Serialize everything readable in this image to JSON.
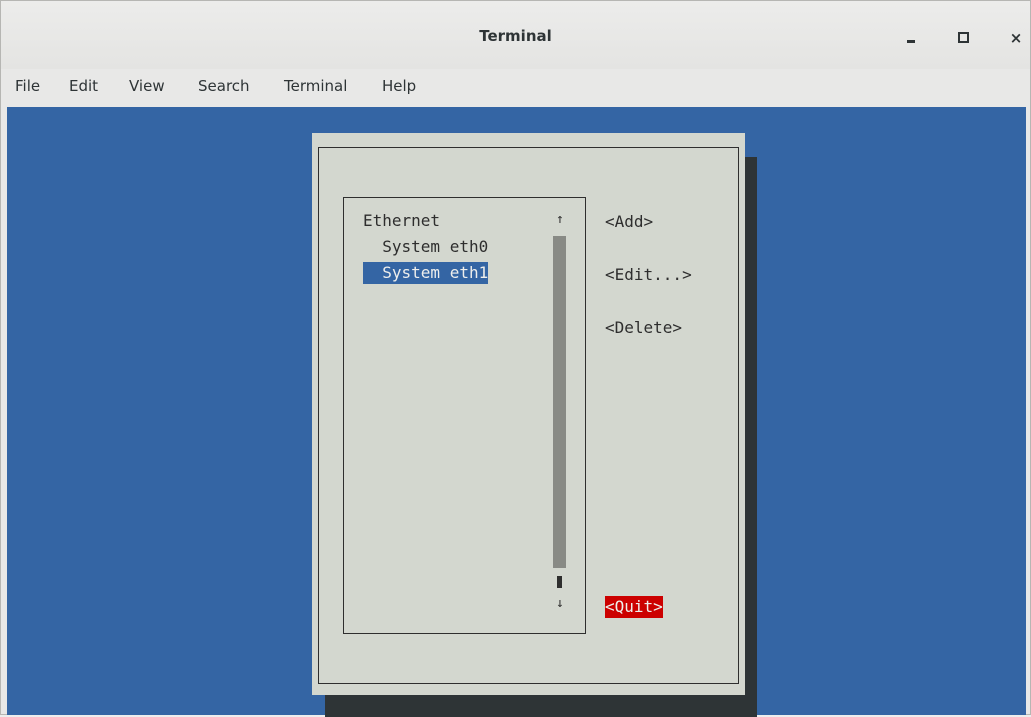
{
  "window": {
    "title": "Terminal",
    "controls": {
      "minimize": "minimize-icon",
      "maximize": "maximize-icon",
      "close": "×"
    }
  },
  "menubar": {
    "items": [
      "File",
      "Edit",
      "View",
      "Search",
      "Terminal",
      "Help"
    ]
  },
  "dialog": {
    "list": {
      "items": [
        {
          "label": "Ethernet",
          "indent": 0,
          "selected": false
        },
        {
          "label": "  System eth0",
          "indent": 1,
          "selected": false
        },
        {
          "label": "  System eth1",
          "indent": 1,
          "selected": true
        }
      ],
      "scroll_up": "↑",
      "scroll_down": "↓"
    },
    "buttons": {
      "add": "<Add>",
      "edit": "<Edit...>",
      "delete": "<Delete>",
      "quit": "<Quit>"
    }
  },
  "colors": {
    "terminal_bg": "#3465a4",
    "dialog_bg": "#d3d7cf",
    "selection_bg": "#3465a4",
    "quit_bg": "#cc0000"
  }
}
